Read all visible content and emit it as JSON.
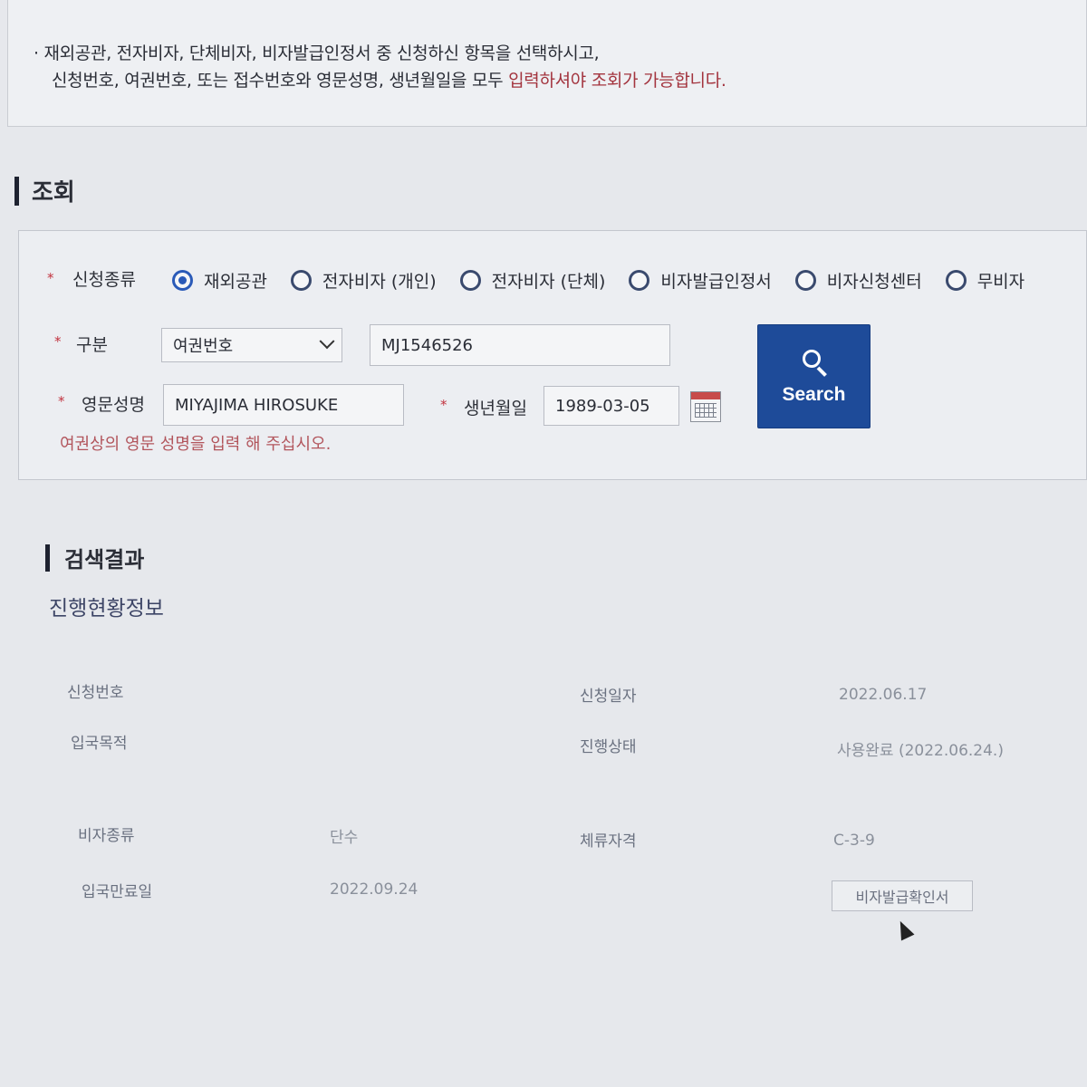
{
  "notice": {
    "line1": "· 재외공관, 전자비자, 단체비자, 비자발급인정서 중 신청하신 항목을 선택하시고,",
    "line2_normal": "신청번호, 여권번호, 또는 접수번호와 영문성명, 생년월일을 모두 ",
    "line2_red": "입력하셔야 조회가 가능합니다."
  },
  "inquiry": {
    "title": "조회",
    "required_mark": "*",
    "type_label": "신청종류",
    "types": [
      {
        "label": "재외공관",
        "selected": true
      },
      {
        "label": "전자비자 (개인)",
        "selected": false
      },
      {
        "label": "전자비자 (단체)",
        "selected": false
      },
      {
        "label": "비자발급인정서",
        "selected": false
      },
      {
        "label": "비자신청센터",
        "selected": false
      },
      {
        "label": "무비자",
        "selected": false
      }
    ],
    "category_label": "구분",
    "category_value": "여권번호",
    "number_value": "MJ1546526",
    "name_label": "영문성명",
    "name_value": "MIYAJIMA HIROSUKE",
    "birth_label": "생년월일",
    "birth_value": "1989-03-05",
    "search_label": "Search",
    "hint": "여권상의 영문 성명을 입력 해 주십시오."
  },
  "results": {
    "title": "검색결과",
    "subtitle": "진행현황정보",
    "app_no_label": "신청번호",
    "app_no_value": "",
    "app_date_label": "신청일자",
    "app_date_value": "2022.06.17",
    "purpose_label": "입국목적",
    "purpose_value": "",
    "status_label": "진행상태",
    "status_value": "사용완료 (2022.06.24.)",
    "visa_type_label": "비자종류",
    "visa_type_value": "단수",
    "stay_label": "체류자격",
    "stay_value": "C-3-9",
    "expiry_label": "입국만료일",
    "expiry_value": "2022.09.24",
    "confirm_button": "비자발급확인서"
  },
  "colors": {
    "accent": "#1e4b99",
    "required": "#c2333f",
    "radio_selected": "#2a5ab8"
  }
}
